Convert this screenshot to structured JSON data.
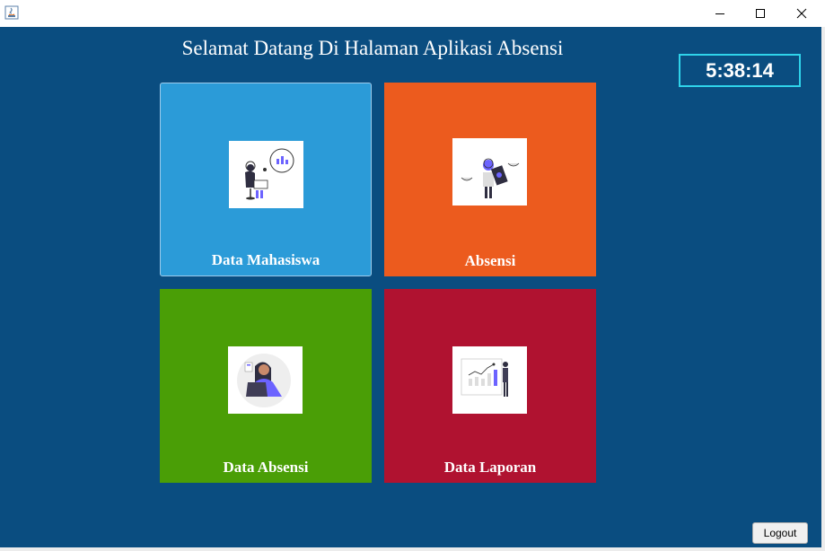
{
  "window": {
    "minimize_icon": "minimize-icon",
    "maximize_icon": "maximize-icon",
    "close_icon": "close-icon",
    "app_icon": "java-app-icon"
  },
  "main": {
    "title": "Selamat Datang Di Halaman Aplikasi Absensi",
    "clock": "5:38:14",
    "tiles": [
      {
        "label": "Data Mahasiswa",
        "color": "#2b9bd8",
        "illustration": "student-data-illustration"
      },
      {
        "label": "Absensi",
        "color": "#ec5b1e",
        "illustration": "attendance-illustration"
      },
      {
        "label": "Data Absensi",
        "color": "#4a9e06",
        "illustration": "attendance-data-illustration"
      },
      {
        "label": "Data Laporan",
        "color": "#b01230",
        "illustration": "report-illustration"
      }
    ],
    "logout_label": "Logout"
  },
  "colors": {
    "background": "#0a4d80",
    "clock_border": "#2fd3ea"
  }
}
